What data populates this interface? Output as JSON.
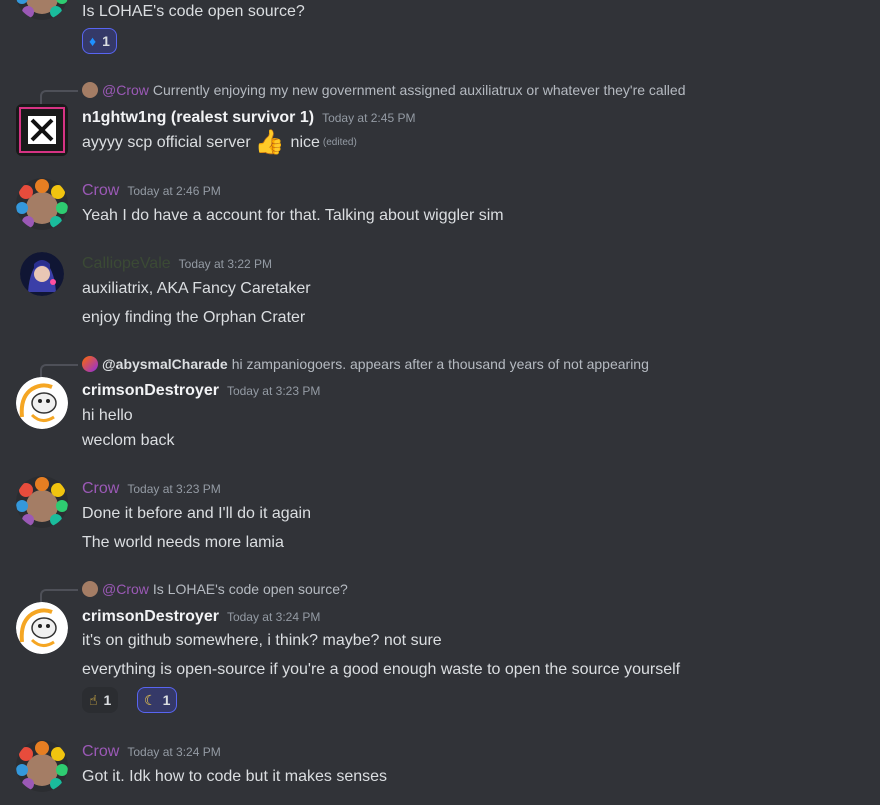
{
  "messages": {
    "m0": {
      "text": "Is LOHAE's code open source?",
      "reaction": {
        "emoji": "♦",
        "count": "1"
      }
    },
    "m1": {
      "reply": {
        "mention": "@Crow",
        "text": "Currently enjoying my new government assigned auxiliatrux or whatever they're called"
      },
      "author": "n1ghtw1ng (realest survivor 1)",
      "time": "Today at 2:45 PM",
      "text_before": "ayyyy scp official server",
      "thumb": "👍",
      "text_after": "nice",
      "edited": "(edited)"
    },
    "m2": {
      "author": "Crow",
      "time": "Today at 2:46 PM",
      "line1": "Yeah I do have a account for that. Talking about wiggler sim"
    },
    "m3": {
      "author": "CalliopeVale",
      "time": "Today at 3:22 PM",
      "line1": "auxiliatrix, AKA Fancy Caretaker",
      "line2": "enjoy finding the Orphan Crater"
    },
    "m4": {
      "reply": {
        "name": "@abysmalCharade",
        "text": "hi zampaniogoers. appears after a thousand years of not appearing"
      },
      "author": "crimsonDestroyer",
      "time": "Today at 3:23 PM",
      "line1": "hi hello",
      "line2": "weclom back"
    },
    "m5": {
      "author": "Crow",
      "time": "Today at 3:23 PM",
      "line1": "Done it before and I'll do it again",
      "line2": "The world needs more lamia"
    },
    "m6": {
      "reply": {
        "mention": "@Crow",
        "text": "Is LOHAE's code open source?"
      },
      "author": "crimsonDestroyer",
      "time": "Today at 3:24 PM",
      "line1": "it's on github somewhere, i think? maybe? not sure",
      "line2": "everything is open-source if you're a good enough waste to open the source yourself",
      "reactions": [
        {
          "emoji": "☝",
          "count": "1"
        },
        {
          "emoji": "☾",
          "count": "1"
        }
      ]
    },
    "m7": {
      "author": "Crow",
      "time": "Today at 3:24 PM",
      "line1": "Got it. Idk how to code but it makes senses"
    }
  },
  "colors": {
    "background": "#313338",
    "crow": "#9b59b6",
    "accent": "#5865f2"
  },
  "icons": {
    "crow_avatar": "flower-wreath-avatar-icon",
    "crimson_avatar": "white-creature-avatar-icon",
    "night_avatar": "x-logo-avatar-icon",
    "calliope_avatar": "anime-portrait-avatar-icon"
  }
}
